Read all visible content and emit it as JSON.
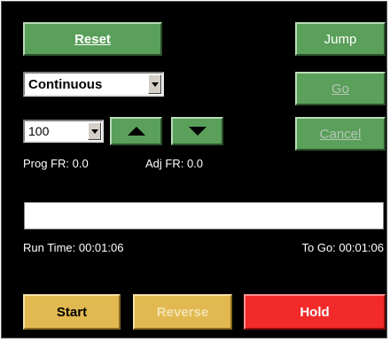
{
  "controls": {
    "reset_label": "Reset",
    "jump_label": "Jump",
    "go_label": "Go",
    "cancel_label": "Cancel",
    "mode_select_value": "Continuous",
    "rate_select_value": "100"
  },
  "status": {
    "prog_fr": "Prog FR: 0.0",
    "adj_fr": "Adj FR: 0.0",
    "progress_fraction": 0,
    "run_time": "Run Time: 00:01:06",
    "to_go": "To Go: 00:01:06"
  },
  "actions": {
    "start_label": "Start",
    "reverse_label": "Reverse",
    "hold_label": "Hold"
  },
  "colors": {
    "panel_bg": "#000000",
    "green_button": "#5a9f5a",
    "yellow_button": "#e2b950",
    "red_button": "#f22a2a"
  },
  "icons": {
    "up": "triangle-up-icon",
    "down": "triangle-down-icon",
    "dropdown": "chevron-down-icon"
  }
}
